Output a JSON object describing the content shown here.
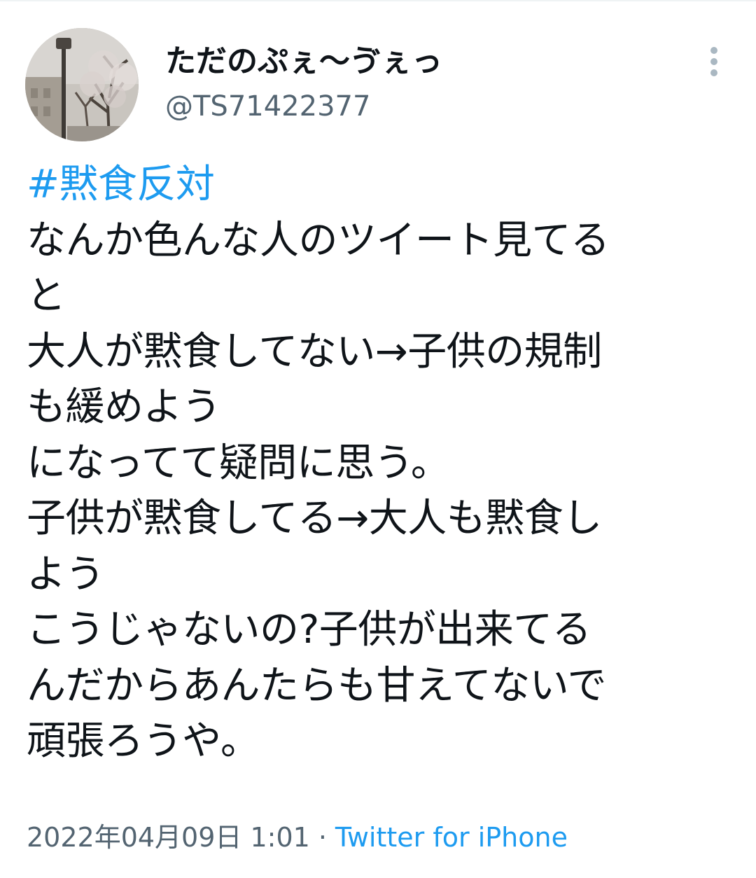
{
  "user": {
    "display_name": "ただのぷぇ〜ゔぇっ",
    "handle": "@TS71422377"
  },
  "tweet": {
    "hashtag": "#黙食反対",
    "lines": [
      "なんか色んな人のツイート見てる",
      "と",
      "大人が黙食してない→子供の規制",
      "も緩めよう",
      "になってて疑問に思う。",
      "子供が黙食してる→大人も黙食し",
      "よう",
      "こうじゃないの?子供が出来てる",
      "んだからあんたらも甘えてないで",
      "頑張ろうや。"
    ]
  },
  "meta": {
    "timestamp": "2022年04月09日 1:01",
    "separator": "·",
    "source": "Twitter for iPhone"
  },
  "icons": {
    "more": "more-vertical-icon",
    "avatar": "profile-photo"
  },
  "colors": {
    "text": "#0f1419",
    "secondary": "#536471",
    "link": "#1d9bf0"
  }
}
